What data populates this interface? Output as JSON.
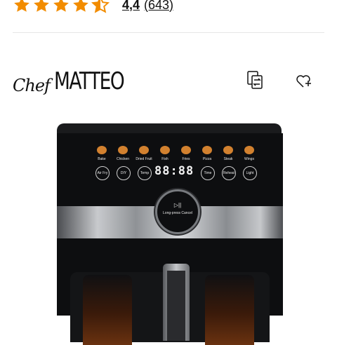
{
  "rating": {
    "stars_filled": 4.4,
    "stars_max": 5,
    "score": "4,4",
    "count": "(643)",
    "star_color": "#f28c00"
  },
  "brand": {
    "prefix": "Chef",
    "name": "MATTEO"
  },
  "actions": {
    "compare_icon": "compare-icon",
    "wishlist_icon": "heart-add-icon"
  },
  "product": {
    "programs": [
      "Bake",
      "Chicken",
      "Dried Fruit",
      "Fish",
      "Fries",
      "Pizza",
      "Steak",
      "Wings"
    ],
    "controls_left": [
      "Air Fry",
      "DIY",
      "Temp"
    ],
    "display": "88:88",
    "controls_right": [
      "Time",
      "Reheat",
      "Light"
    ],
    "knob_symbol": "▷||",
    "knob_text": "Long-press Cancel"
  }
}
